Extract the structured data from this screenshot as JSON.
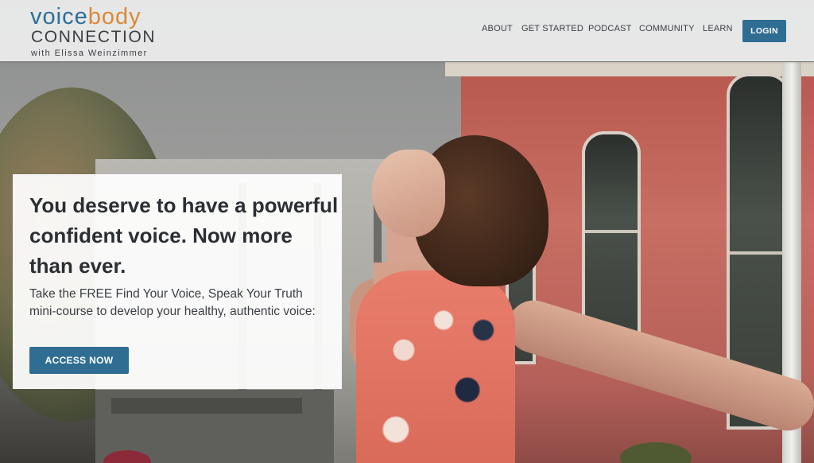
{
  "brand": {
    "logo_word1": "voice",
    "logo_word2": "body",
    "logo_line2": "CONNECTION",
    "logo_line3": "with Elissa Weinzimmer",
    "color_primary": "#2f6d93",
    "color_accent": "#d98a3a"
  },
  "nav": {
    "items": [
      "ABOUT",
      "GET STARTED",
      "PODCAST",
      "COMMUNITY",
      "LEARN"
    ],
    "login_label": "LOGIN"
  },
  "hero": {
    "headline": "You deserve to have a powerful confident voice. Now more than ever.",
    "subtext": "Take the FREE Find Your Voice, Speak Your Truth mini-course to develop your healthy, authentic voice:",
    "cta_label": "ACCESS NOW"
  }
}
